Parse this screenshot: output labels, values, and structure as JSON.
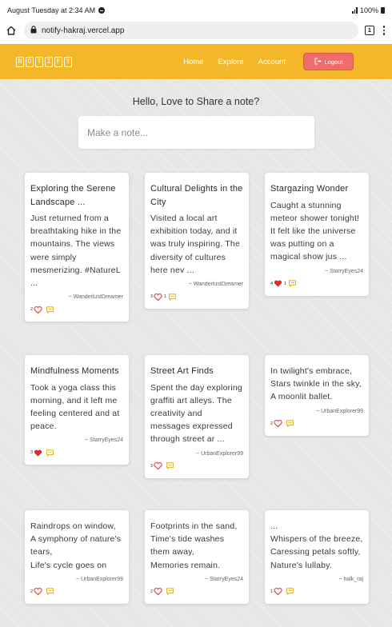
{
  "status_bar": {
    "time": "August Tuesday at 2:34 AM",
    "battery": "100%"
  },
  "browser": {
    "url": "notify-hakraj.vercel.app",
    "tab_count": "1"
  },
  "nav": {
    "logo_letters": [
      "N",
      "O",
      "T",
      "I",
      "F",
      "Y"
    ],
    "links": [
      "Home",
      "Explore",
      "Account"
    ],
    "logout_label": "Logout"
  },
  "greeting": "Hello, Love to Share a note?",
  "note_input": {
    "placeholder": "Make a note..."
  },
  "colors": {
    "brand": "#f3b82a",
    "logout": "#f06b6b",
    "heart_active": "#e12b2b",
    "heart_outline": "#e84a4a",
    "comment": "#e6b91e"
  },
  "notes": [
    {
      "title": "Exploring the Serene Landscape ...",
      "body": "Just returned from a breathtaking hike in the mountains. The views were simply mesmerizing. #NatureL ...",
      "author": "~ WanderlustDreamer",
      "likes": "2",
      "liked": false,
      "comments": ""
    },
    {
      "title": "Cultural Delights in the City",
      "body": "Visited a local art exhibition today, and it was truly inspiring. The diversity of cultures here nev ...",
      "author": "~ WanderlustDreamer",
      "likes": "3",
      "liked": false,
      "comments": "1"
    },
    {
      "title": "Stargazing Wonder",
      "body": "Caught a stunning meteor shower tonight! It felt like the universe was putting on a magical show jus ...",
      "author": "~ StarryEyes24",
      "likes": "4",
      "liked": true,
      "comments": "1"
    },
    {
      "title": "Mindfulness Moments",
      "body": "Took a yoga class this morning, and it left me feeling centered and at peace.",
      "author": "~ StarryEyes24",
      "likes": "3",
      "liked": true,
      "comments": ""
    },
    {
      "title": "Street Art Finds",
      "body": "Spent the day exploring graffiti art alleys. The creativity and messages expressed through street ar ...",
      "author": "~ UrbanExplorer99",
      "likes": "3",
      "liked": false,
      "comments": ""
    },
    {
      "title": "",
      "body": "In twilight's embrace,\nStars twinkle in the sky,\nA moonlit ballet.",
      "author": "~ UrbanExplorer99",
      "likes": "2",
      "liked": false,
      "comments": ""
    },
    {
      "title": "",
      "body": "Raindrops on window,\nA symphony of nature's tears,\nLife's cycle goes on",
      "author": "~ UrbanExplorer99",
      "likes": "2",
      "liked": false,
      "comments": ""
    },
    {
      "title": "",
      "body": "Footprints in the sand,\nTime's tide washes them away,\nMemories remain.",
      "author": "~ StarryEyes24",
      "likes": "2",
      "liked": false,
      "comments": ""
    },
    {
      "title": "",
      "body": "...\nWhispers of the breeze,\nCaressing petals softly,\nNature's lullaby.",
      "author": "~ halk_raj",
      "likes": "1",
      "liked": false,
      "comments": ""
    }
  ]
}
